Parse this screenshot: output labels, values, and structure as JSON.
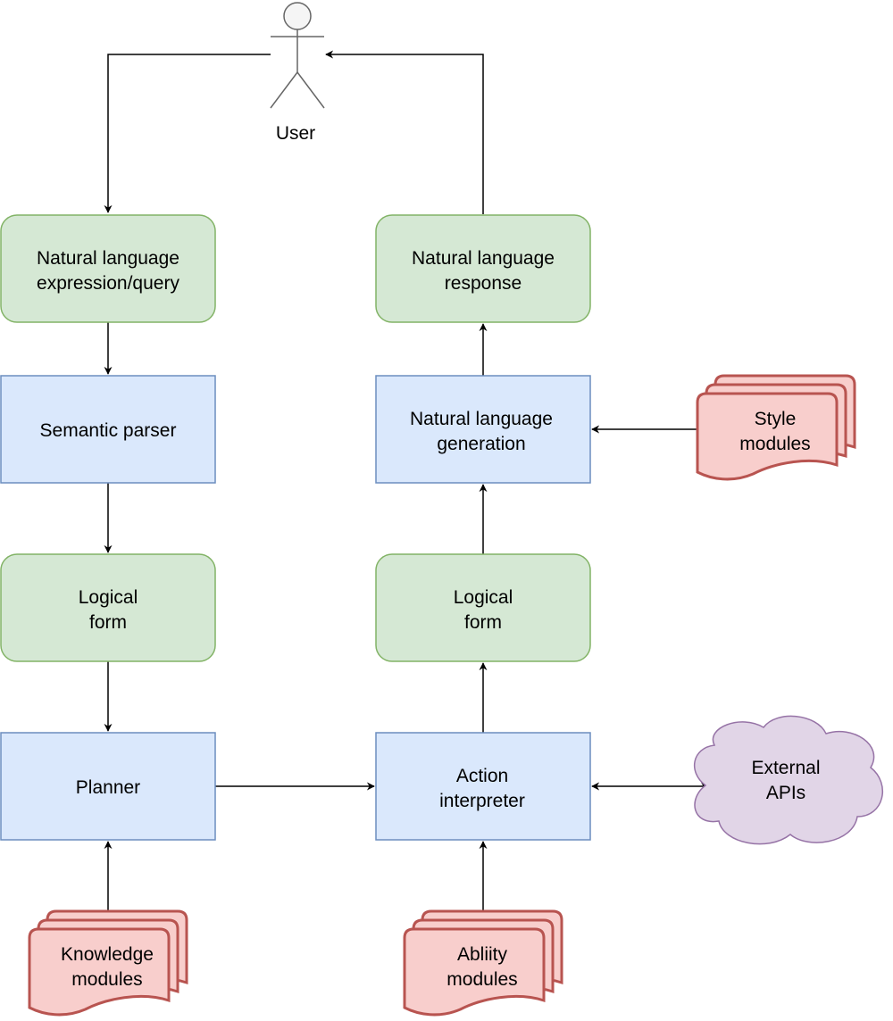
{
  "colors": {
    "green_fill": "#d5e8d4",
    "green_stroke": "#82b366",
    "blue_fill": "#dae8fc",
    "blue_stroke": "#6c8ebf",
    "red_fill": "#f8cecc",
    "red_stroke": "#b85450",
    "purple_fill": "#e1d5e7",
    "purple_stroke": "#9673a6",
    "actor_fill": "#f5f5f5",
    "actor_stroke": "#666666"
  },
  "user": {
    "label": "User",
    "icon": "stick-figure-actor"
  },
  "nodes": {
    "nl_query": {
      "lines": [
        "Natural language",
        "expression/query"
      ]
    },
    "semantic_parser": {
      "lines": [
        "Semantic parser"
      ]
    },
    "logical_form_left": {
      "lines": [
        "Logical",
        "form"
      ]
    },
    "planner": {
      "lines": [
        "Planner"
      ]
    },
    "nl_response": {
      "lines": [
        "Natural language",
        "response"
      ]
    },
    "nlg": {
      "lines": [
        "Natural language",
        "generation"
      ]
    },
    "logical_form_right": {
      "lines": [
        "Logical",
        "form"
      ]
    },
    "action_interpreter": {
      "lines": [
        "Action",
        "interpreter"
      ]
    },
    "style_modules": {
      "lines": [
        "Style",
        "modules"
      ]
    },
    "knowledge_modules": {
      "lines": [
        "Knowledge",
        "modules"
      ]
    },
    "ability_modules": {
      "lines": [
        "Abliity",
        "modules"
      ]
    },
    "external_apis": {
      "lines": [
        "External",
        "APIs"
      ]
    }
  }
}
